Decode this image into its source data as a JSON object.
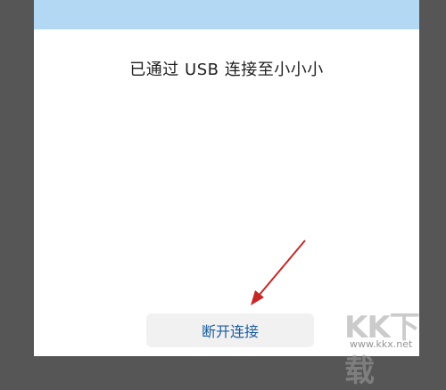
{
  "dialog": {
    "message": "已通过 USB 连接至小小小",
    "disconnect_label": "断开连接"
  },
  "watermark": {
    "main": "KK下载",
    "url": "www.kkx.net"
  },
  "colors": {
    "header_band": "#b3d8f3",
    "button_text": "#1c5da0",
    "arrow": "#c62828"
  }
}
